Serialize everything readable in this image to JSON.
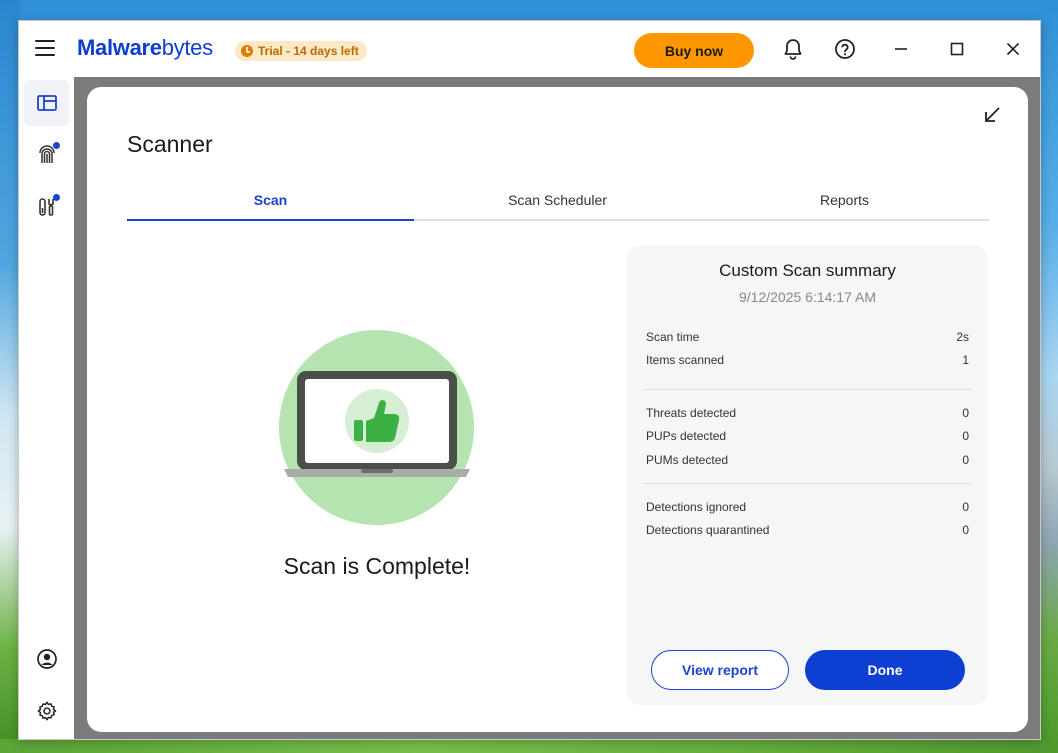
{
  "app": {
    "brand_bold": "Malware",
    "brand_rest": "bytes",
    "trial_badge": "Trial - 14 days left",
    "buy_label": "Buy now"
  },
  "icons": {
    "menu": "hamburger-icon",
    "notifications": "bell-icon",
    "help": "question-circle-icon",
    "minimize": "minimize-icon",
    "maximize": "maximize-icon",
    "close": "close-icon",
    "dashboard": "dashboard-icon",
    "identity": "fingerprint-icon",
    "tools": "tools-icon",
    "account": "account-icon",
    "settings": "gear-icon",
    "collapse": "collapse-arrow-icon",
    "illustration": "laptop-thumbs-up-icon"
  },
  "colors": {
    "brand": "#0d3ed1",
    "accent": "#ff9800",
    "primary_button": "#0e3fd3",
    "success_green": "#3cb043",
    "badge_dot": "#1a44cf"
  },
  "scanner": {
    "title": "Scanner",
    "tabs": [
      {
        "label": "Scan",
        "active": true
      },
      {
        "label": "Scan Scheduler",
        "active": false
      },
      {
        "label": "Reports",
        "active": false
      }
    ],
    "status_message": "Scan is Complete!"
  },
  "summary": {
    "title": "Custom Scan summary",
    "date": "9/12/2025 6:14:17 AM",
    "group1": [
      {
        "label": "Scan time",
        "value": "2s"
      },
      {
        "label": "Items scanned",
        "value": "1"
      }
    ],
    "group2": [
      {
        "label": "Threats detected",
        "value": "0"
      },
      {
        "label": "PUPs detected",
        "value": "0"
      },
      {
        "label": "PUMs detected",
        "value": "0"
      }
    ],
    "group3": [
      {
        "label": "Detections ignored",
        "value": "0"
      },
      {
        "label": "Detections quarantined",
        "value": "0"
      }
    ],
    "view_report_label": "View report",
    "done_label": "Done"
  }
}
